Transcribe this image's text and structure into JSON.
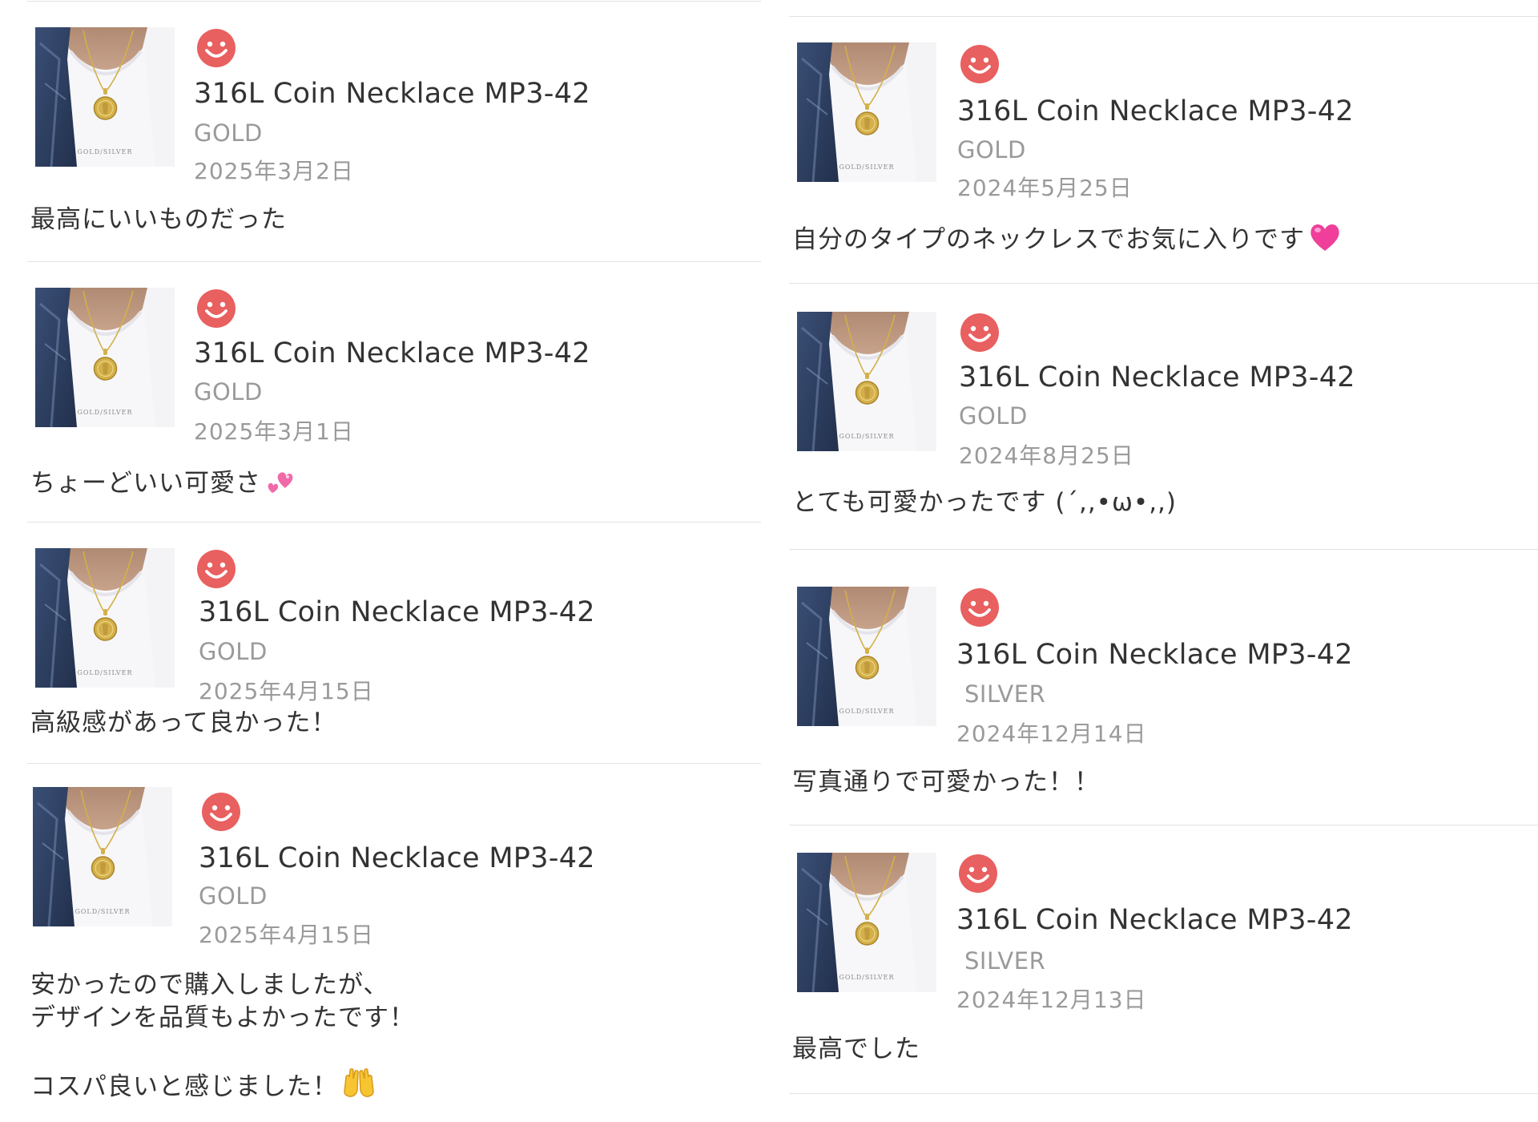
{
  "reviews_left": [
    {
      "product": "316L Coin Necklace MP3-42",
      "variant": "GOLD",
      "date": "2025年3月2日",
      "comment": "最高にいいものだった",
      "emoji": ""
    },
    {
      "product": "316L Coin Necklace MP3-42",
      "variant": "GOLD",
      "date": "2025年3月1日",
      "comment": "ちょーどいい可愛さ",
      "emoji": "two-hearts-icon"
    },
    {
      "product": "316L Coin Necklace MP3-42",
      "variant": "GOLD",
      "date": "2025年4月15日",
      "comment": "高級感があって良かった！",
      "emoji": ""
    },
    {
      "product": "316L Coin Necklace MP3-42",
      "variant": "GOLD",
      "date": "2025年4月15日",
      "comment": "安かったので購入しましたが、\nデザインを品質もよかったです！\n\nコスパ良いと感じました！",
      "emoji": "raised-hands-icon"
    }
  ],
  "reviews_right": [
    {
      "product": "316L Coin Necklace MP3-42",
      "variant": "GOLD",
      "date": "2024年5月25日",
      "comment": "自分のタイプのネックレスでお気に入りです",
      "emoji": "pink-heart-icon"
    },
    {
      "product": "316L Coin Necklace MP3-42",
      "variant": "GOLD",
      "date": "2024年8月25日",
      "comment": "とても可愛かったです (´,,•ω•,,)",
      "emoji": ""
    },
    {
      "product": "316L Coin Necklace MP3-42",
      "variant": "SILVER",
      "date": "2024年12月14日",
      "comment": "写真通りで可愛かった！！",
      "emoji": ""
    },
    {
      "product": "316L Coin Necklace MP3-42",
      "variant": "SILVER",
      "date": "2024年12月13日",
      "comment": "最高でした",
      "emoji": ""
    }
  ],
  "thumbnail": {
    "caption": "GOLD/SILVER"
  },
  "colors": {
    "smiley": "#e8605f",
    "text": "#333333",
    "muted": "#9a9a9a",
    "divider": "#e2e2e2",
    "gold": "#d4b04a"
  }
}
